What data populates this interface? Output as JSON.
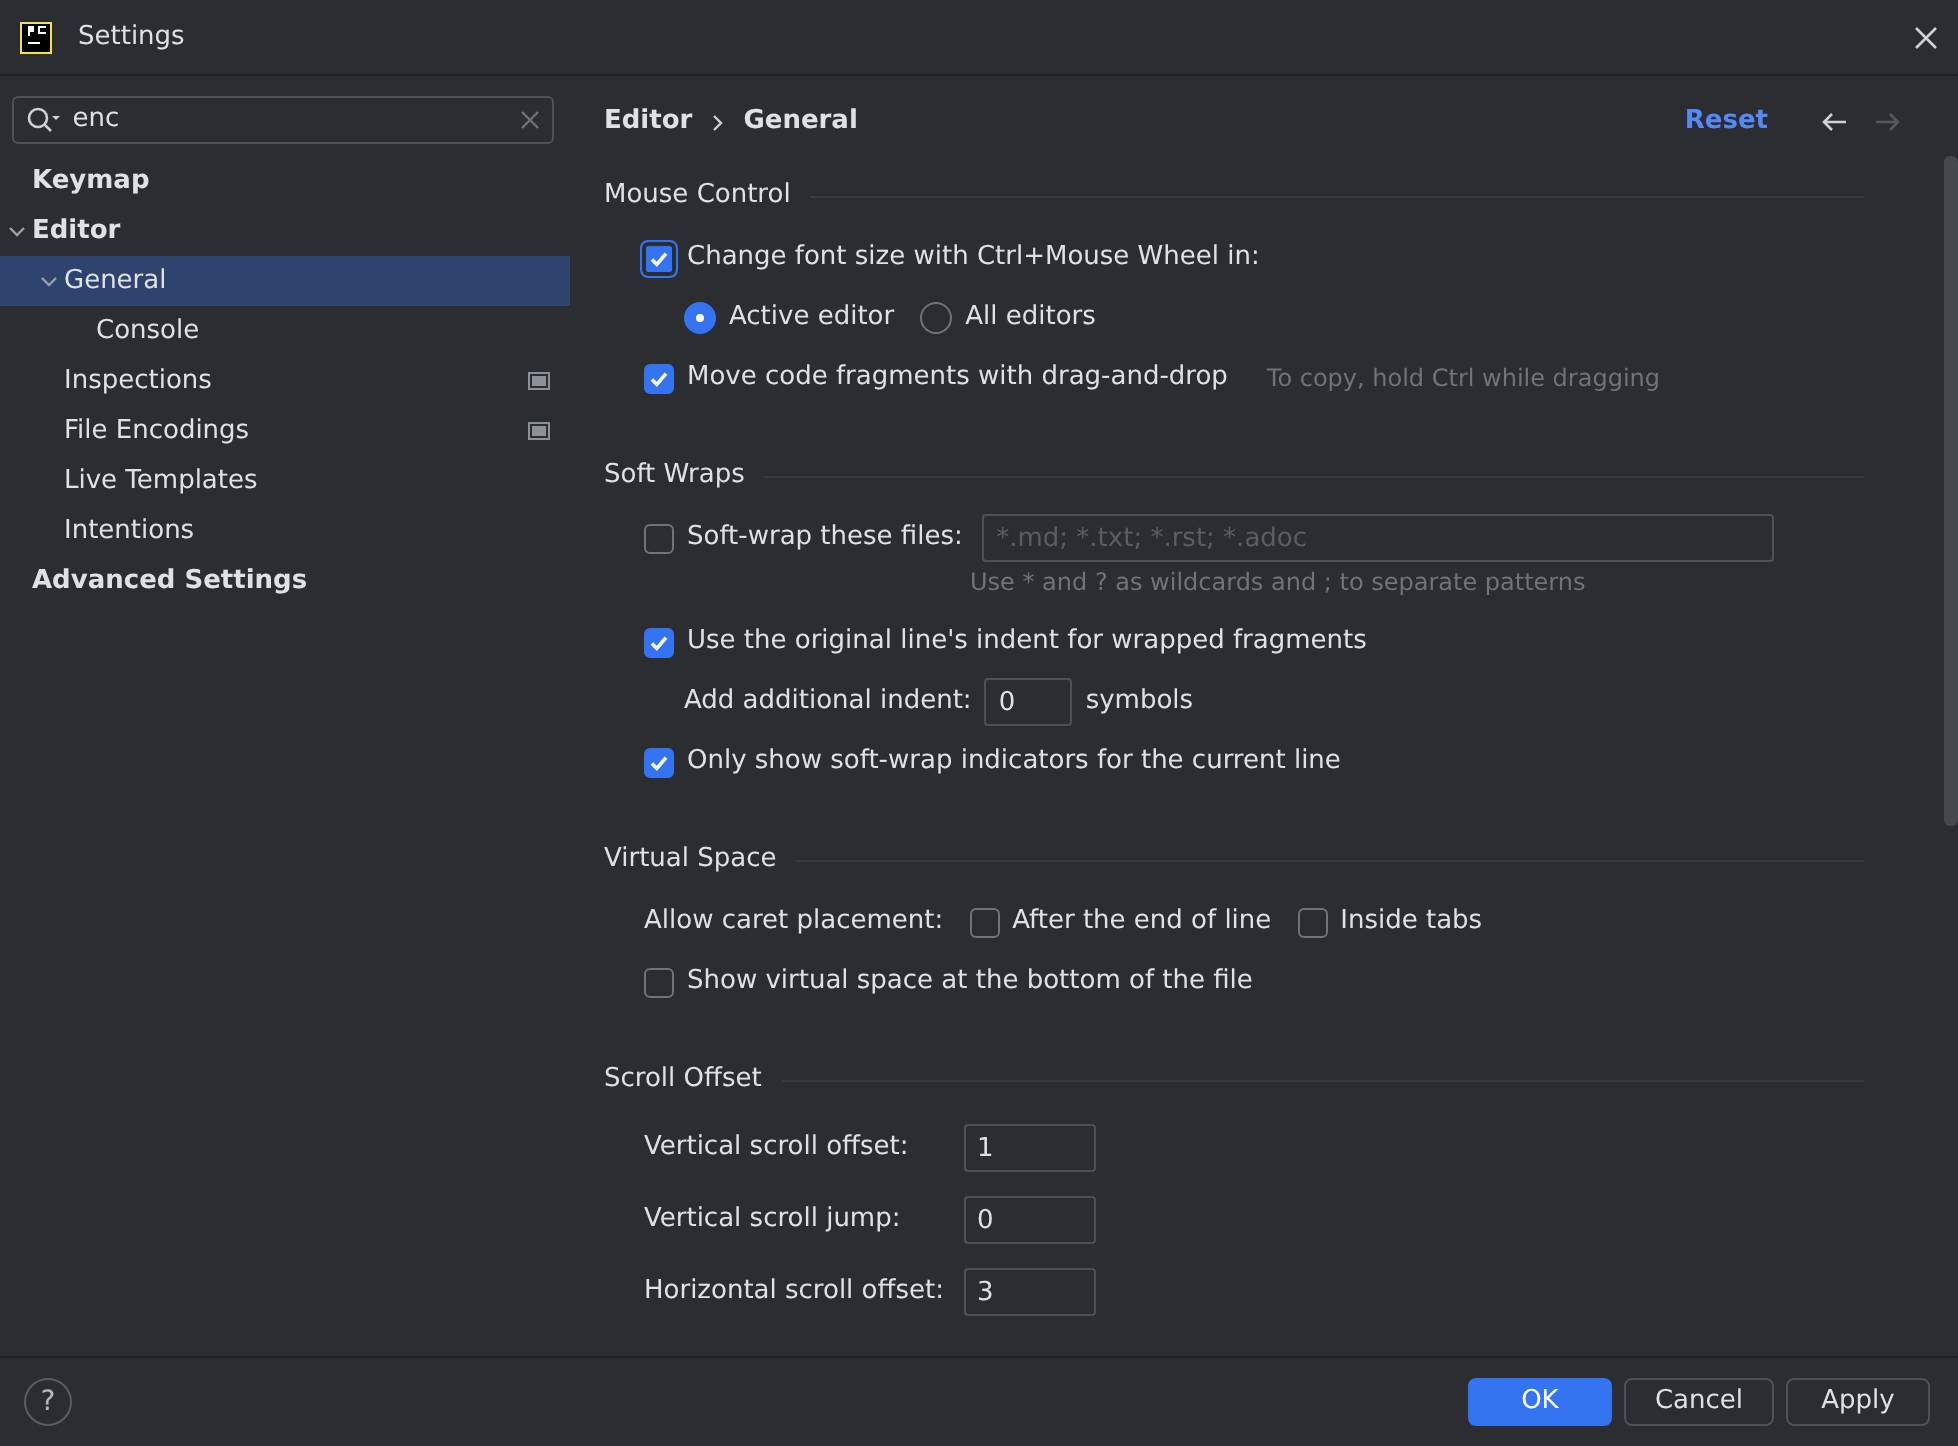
{
  "window": {
    "title": "Settings"
  },
  "search": {
    "value": "enc"
  },
  "tree": [
    {
      "label": "Keymap",
      "selected": false,
      "marked": false
    },
    {
      "label": "Editor",
      "selected": false,
      "marked": false,
      "expanded": true,
      "children": [
        {
          "label": "General",
          "selected": true,
          "marked": false,
          "expanded": true,
          "children": [
            {
              "label": "Console",
              "selected": false,
              "marked": false
            }
          ]
        },
        {
          "label": "Inspections",
          "selected": false,
          "marked": true
        },
        {
          "label": "File Encodings",
          "selected": false,
          "marked": true
        },
        {
          "label": "Live Templates",
          "selected": false,
          "marked": false
        },
        {
          "label": "Intentions",
          "selected": false,
          "marked": false
        }
      ]
    },
    {
      "label": "Advanced Settings",
      "selected": false,
      "marked": false
    }
  ],
  "breadcrumb": [
    "Editor",
    "General"
  ],
  "reset": "Reset",
  "back": {
    "disabled": false
  },
  "forward": {
    "disabled": true
  },
  "sections": [
    {
      "title": "Mouse Control",
      "rows": [
        {
          "kind": "checkbox",
          "label": "Change font size with Ctrl+Mouse Wheel in:",
          "checked": true,
          "focused": true,
          "children": [
            {
              "kind": "radios",
              "options": [
                {
                  "label": "Active editor",
                  "selected": true
                },
                {
                  "label": "All editors",
                  "selected": false
                }
              ]
            }
          ]
        },
        {
          "kind": "checkbox",
          "label": "Move code fragments with drag-and-drop",
          "checked": true,
          "hint": "To copy, hold Ctrl while dragging"
        }
      ]
    },
    {
      "title": "Soft Wraps",
      "rows": [
        {
          "kind": "checkfield",
          "label": "Soft-wrap these files:",
          "checked": false,
          "placeholder": "*.md; *.txt; *.rst; *.adoc",
          "note": "Use * and ? as wildcards and ; to separate patterns"
        },
        {
          "kind": "checkbox",
          "label": "Use the original line's indent for wrapped fragments",
          "checked": true,
          "children": [
            {
              "kind": "number",
              "label": "Add additional indent:",
              "value": "0",
              "unit": "symbols"
            }
          ]
        },
        {
          "kind": "checkbox",
          "label": "Only show soft-wrap indicators for the current line",
          "checked": true
        }
      ]
    },
    {
      "title": "Virtual Space",
      "rows": [
        {
          "kind": "checks",
          "label": "Allow caret placement:",
          "options": [
            {
              "label": "After the end of line",
              "checked": false
            },
            {
              "label": "Inside tabs",
              "checked": false
            }
          ]
        },
        {
          "kind": "checkbox",
          "label": "Show virtual space at the bottom of the file",
          "checked": false
        }
      ]
    },
    {
      "title": "Scroll Offset",
      "rows": [
        {
          "kind": "field",
          "label": "Vertical scroll offset:",
          "value": "1"
        },
        {
          "kind": "field",
          "label": "Vertical scroll jump:",
          "value": "0"
        },
        {
          "kind": "field",
          "label": "Horizontal scroll offset:",
          "value": "3"
        }
      ]
    }
  ],
  "help": {
    "label": "?"
  },
  "buttons": [
    {
      "label": "OK",
      "kind": "primary"
    },
    {
      "label": "Cancel",
      "kind": "default"
    },
    {
      "label": "Apply",
      "kind": "default"
    }
  ]
}
